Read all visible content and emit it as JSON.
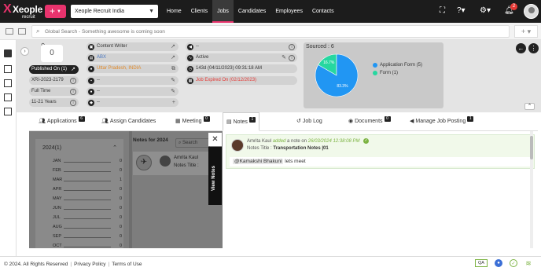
{
  "app": {
    "logo_brand": "Xeople",
    "logo_sub": "recruit",
    "company": "Xeople Recruit India"
  },
  "nav": [
    "Home",
    "Clients",
    "Jobs",
    "Candidates",
    "Employees",
    "Contacts"
  ],
  "notifications_count": "2",
  "search": {
    "placeholder": "Global Search - Something awesome is coming soon"
  },
  "summary": {
    "score": "0",
    "published": "Published On (1)",
    "job_code": "XRI-2023-2179",
    "job_type": "Full Time",
    "experience": "11-21 Years",
    "col2": {
      "title": "Content Writer",
      "company": "ABX",
      "location": "Uttar Pradesh, INDIA",
      "dash1": "--",
      "dash2": "--",
      "dash3": "--"
    },
    "col3": {
      "dash": "--",
      "status": "Active",
      "created": "143d (04/11/2023) 09:31:18 AM",
      "expired": "Job Expired On (02/12/2023)"
    }
  },
  "sourced": {
    "label": "Sourced : 6"
  },
  "chart_data": {
    "type": "pie",
    "categories": [
      "Application Form (5)",
      "Form (1)"
    ],
    "values": [
      83.3,
      16.7
    ],
    "slice_labels": [
      "83.3%",
      "16.7%"
    ],
    "colors": [
      "#2196f3",
      "#26d7a0"
    ],
    "legend_position": "right"
  },
  "tabs": [
    {
      "label": "Applications",
      "count": "6"
    },
    {
      "label": "Assign Candidates",
      "count": ""
    },
    {
      "label": "Meeting",
      "count": "0"
    },
    {
      "label": "Notes",
      "count": "1"
    },
    {
      "label": "Job Log",
      "count": ""
    },
    {
      "label": "Documents",
      "count": "0"
    },
    {
      "label": "Manage Job Posting",
      "count": "1"
    }
  ],
  "notes_panel": {
    "year": "2024(1)",
    "months": [
      {
        "name": "JAN",
        "count": "0"
      },
      {
        "name": "FEB",
        "count": "0"
      },
      {
        "name": "MAR",
        "count": "1"
      },
      {
        "name": "APR",
        "count": "0"
      },
      {
        "name": "MAY",
        "count": "0"
      },
      {
        "name": "JUN",
        "count": "0"
      },
      {
        "name": "JUL",
        "count": "0"
      },
      {
        "name": "AUG",
        "count": "0"
      },
      {
        "name": "SEP",
        "count": "0"
      },
      {
        "name": "OCT",
        "count": "0"
      }
    ],
    "notes_for": "Notes for 2024",
    "search_label": "Search",
    "mini_name": "Amrita Kaul",
    "mini_title": "Notes Title :",
    "view_notes": "View Notes"
  },
  "note": {
    "author": "Amrita Kaul",
    "added": "added",
    "mid": "a note on",
    "date": "26/03/2024 12:38:08 PM",
    "title_label": "Notes Title :",
    "title_value": "Transportation Notes |01",
    "mention": "@Kamakshi Bhakuni",
    "body": "lets meet"
  },
  "footer": {
    "copyright": "© 2024. All Rights Reserved",
    "privacy": "Privacy Policy",
    "terms": "Terms of Use",
    "qa": "QA"
  }
}
